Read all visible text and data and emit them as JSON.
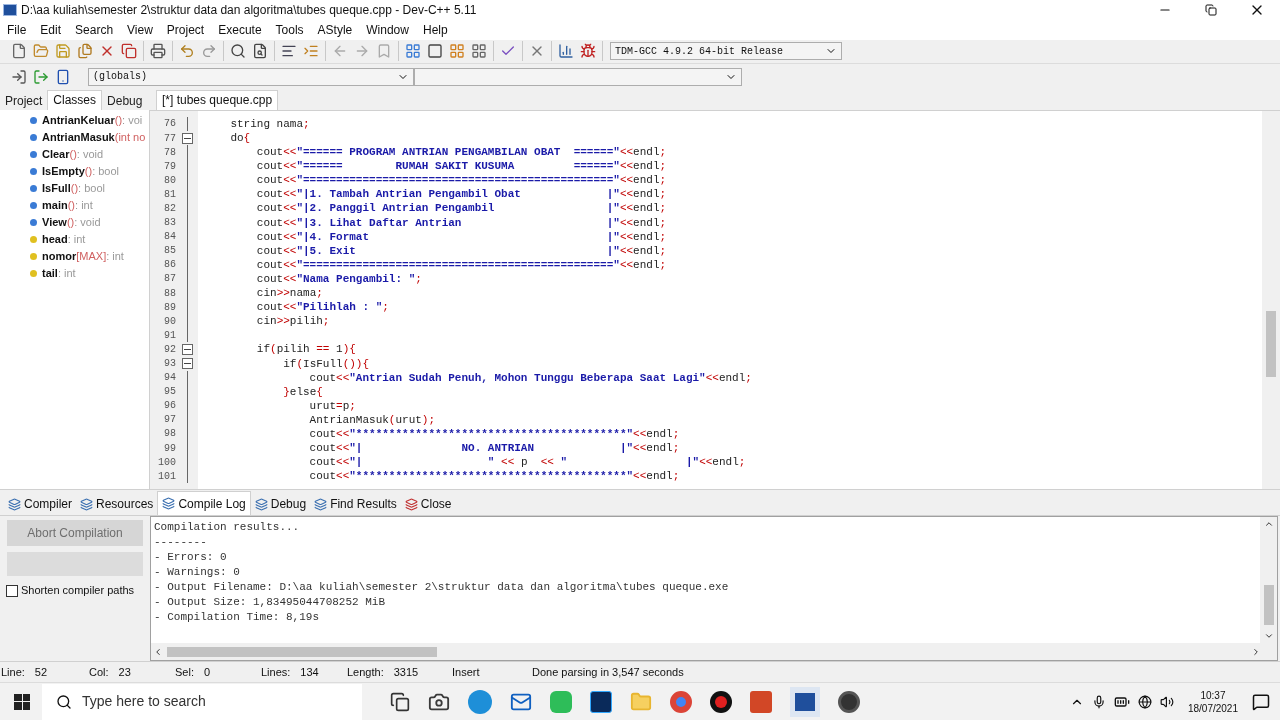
{
  "window": {
    "title": "D:\\aa kuliah\\semester 2\\struktur data dan algoritma\\tubes queque.cpp - Dev-C++ 5.11"
  },
  "menu": [
    "File",
    "Edit",
    "Search",
    "View",
    "Project",
    "Execute",
    "Tools",
    "AStyle",
    "Window",
    "Help"
  ],
  "compiler_select": {
    "value": "TDM-GCC 4.9.2 64-bit Release"
  },
  "scope_select": {
    "value": "(globals)"
  },
  "left_tabs": [
    {
      "label": "Project",
      "selected": false
    },
    {
      "label": "Classes",
      "selected": true
    },
    {
      "label": "Debug",
      "selected": false
    }
  ],
  "class_tree": [
    {
      "kind": "method",
      "name": "AntrianKeluar",
      "params": "()",
      "type": " : voi"
    },
    {
      "kind": "method",
      "name": "AntrianMasuk",
      "params": "(int no"
    },
    {
      "kind": "method",
      "name": "Clear",
      "params": "()",
      "type": " : void"
    },
    {
      "kind": "method",
      "name": "IsEmpty",
      "params": "()",
      "type": " : bool"
    },
    {
      "kind": "method",
      "name": "IsFull",
      "params": "()",
      "type": " : bool"
    },
    {
      "kind": "method",
      "name": "main",
      "params": "()",
      "type": " : int"
    },
    {
      "kind": "method",
      "name": "View",
      "params": "()",
      "type": " : void"
    },
    {
      "kind": "field",
      "name": "head",
      "type": " : int"
    },
    {
      "kind": "field",
      "name": "nomor",
      "params": " [MAX]",
      "type": " : int"
    },
    {
      "kind": "field",
      "name": "tail",
      "type": " : int"
    }
  ],
  "editor_tab": {
    "label": "[*] tubes queque.cpp"
  },
  "code": [
    {
      "n": "76",
      "fold": false,
      "segs": [
        {
          "kind": "id",
          "text": "    string nama"
        },
        {
          "kind": "op",
          "text": ";"
        }
      ]
    },
    {
      "n": "77",
      "fold": true,
      "segs": [
        {
          "kind": "id",
          "text": "    do"
        },
        {
          "kind": "op",
          "text": "{"
        }
      ]
    },
    {
      "n": "78",
      "fold": false,
      "segs": [
        {
          "kind": "id",
          "text": "        cout"
        },
        {
          "kind": "op",
          "text": "<<"
        },
        {
          "kind": "str",
          "text": "\"====== PROGRAM ANTRIAN PENGAMBILAN OBAT  ======\""
        },
        {
          "kind": "op",
          "text": "<<"
        },
        {
          "kind": "id",
          "text": "endl"
        },
        {
          "kind": "op",
          "text": ";"
        }
      ]
    },
    {
      "n": "79",
      "fold": false,
      "segs": [
        {
          "kind": "id",
          "text": "        cout"
        },
        {
          "kind": "op",
          "text": "<<"
        },
        {
          "kind": "str",
          "text": "\"======        RUMAH SAKIT KUSUMA         ======\""
        },
        {
          "kind": "op",
          "text": "<<"
        },
        {
          "kind": "id",
          "text": "endl"
        },
        {
          "kind": "op",
          "text": ";"
        }
      ]
    },
    {
      "n": "80",
      "fold": false,
      "segs": [
        {
          "kind": "id",
          "text": "        cout"
        },
        {
          "kind": "op",
          "text": "<<"
        },
        {
          "kind": "str",
          "text": "\"===============================================\""
        },
        {
          "kind": "op",
          "text": "<<"
        },
        {
          "kind": "id",
          "text": "endl"
        },
        {
          "kind": "op",
          "text": ";"
        }
      ]
    },
    {
      "n": "81",
      "fold": false,
      "segs": [
        {
          "kind": "id",
          "text": "        cout"
        },
        {
          "kind": "op",
          "text": "<<"
        },
        {
          "kind": "str",
          "text": "\"|1. Tambah Antrian Pengambil Obat             |\""
        },
        {
          "kind": "op",
          "text": "<<"
        },
        {
          "kind": "id",
          "text": "endl"
        },
        {
          "kind": "op",
          "text": ";"
        }
      ]
    },
    {
      "n": "82",
      "fold": false,
      "segs": [
        {
          "kind": "id",
          "text": "        cout"
        },
        {
          "kind": "op",
          "text": "<<"
        },
        {
          "kind": "str",
          "text": "\"|2. Panggil Antrian Pengambil                 |\""
        },
        {
          "kind": "op",
          "text": "<<"
        },
        {
          "kind": "id",
          "text": "endl"
        },
        {
          "kind": "op",
          "text": ";"
        }
      ]
    },
    {
      "n": "83",
      "fold": false,
      "segs": [
        {
          "kind": "id",
          "text": "        cout"
        },
        {
          "kind": "op",
          "text": "<<"
        },
        {
          "kind": "str",
          "text": "\"|3. Lihat Daftar Antrian                      |\""
        },
        {
          "kind": "op",
          "text": "<<"
        },
        {
          "kind": "id",
          "text": "endl"
        },
        {
          "kind": "op",
          "text": ";"
        }
      ]
    },
    {
      "n": "84",
      "fold": false,
      "segs": [
        {
          "kind": "id",
          "text": "        cout"
        },
        {
          "kind": "op",
          "text": "<<"
        },
        {
          "kind": "str",
          "text": "\"|4. Format                                    |\""
        },
        {
          "kind": "op",
          "text": "<<"
        },
        {
          "kind": "id",
          "text": "endl"
        },
        {
          "kind": "op",
          "text": ";"
        }
      ]
    },
    {
      "n": "85",
      "fold": false,
      "segs": [
        {
          "kind": "id",
          "text": "        cout"
        },
        {
          "kind": "op",
          "text": "<<"
        },
        {
          "kind": "str",
          "text": "\"|5. Exit                                      |\""
        },
        {
          "kind": "op",
          "text": "<<"
        },
        {
          "kind": "id",
          "text": "endl"
        },
        {
          "kind": "op",
          "text": ";"
        }
      ]
    },
    {
      "n": "86",
      "fold": false,
      "segs": [
        {
          "kind": "id",
          "text": "        cout"
        },
        {
          "kind": "op",
          "text": "<<"
        },
        {
          "kind": "str",
          "text": "\"===============================================\""
        },
        {
          "kind": "op",
          "text": "<<"
        },
        {
          "kind": "id",
          "text": "endl"
        },
        {
          "kind": "op",
          "text": ";"
        }
      ]
    },
    {
      "n": "87",
      "fold": false,
      "segs": [
        {
          "kind": "id",
          "text": "        cout"
        },
        {
          "kind": "op",
          "text": "<<"
        },
        {
          "kind": "str",
          "text": "\"Nama Pengambil: \""
        },
        {
          "kind": "op",
          "text": ";"
        }
      ]
    },
    {
      "n": "88",
      "fold": false,
      "segs": [
        {
          "kind": "id",
          "text": "        cin"
        },
        {
          "kind": "op",
          "text": ">>"
        },
        {
          "kind": "id",
          "text": "nama"
        },
        {
          "kind": "op",
          "text": ";"
        }
      ]
    },
    {
      "n": "89",
      "fold": false,
      "segs": [
        {
          "kind": "id",
          "text": "        cout"
        },
        {
          "kind": "op",
          "text": "<<"
        },
        {
          "kind": "str",
          "text": "\"Pilihlah : \""
        },
        {
          "kind": "op",
          "text": ";"
        }
      ]
    },
    {
      "n": "90",
      "fold": false,
      "segs": [
        {
          "kind": "id",
          "text": "        cin"
        },
        {
          "kind": "op",
          "text": ">>"
        },
        {
          "kind": "id",
          "text": "pilih"
        },
        {
          "kind": "op",
          "text": ";"
        }
      ]
    },
    {
      "n": "91",
      "fold": false
    },
    {
      "n": "92",
      "fold": true,
      "segs": [
        {
          "kind": "id",
          "text": "        if"
        },
        {
          "kind": "op",
          "text": "("
        },
        {
          "kind": "id",
          "text": "pilih "
        },
        {
          "kind": "op",
          "text": "=="
        },
        {
          "kind": "id",
          "text": " 1"
        },
        {
          "kind": "op",
          "text": "){"
        }
      ]
    },
    {
      "n": "93",
      "fold": true,
      "segs": [
        {
          "kind": "id",
          "text": "            if"
        },
        {
          "kind": "op",
          "text": "("
        },
        {
          "kind": "id",
          "text": "IsFull"
        },
        {
          "kind": "op",
          "text": "()){"
        }
      ]
    },
    {
      "n": "94",
      "fold": false,
      "segs": [
        {
          "kind": "id",
          "text": "                cout"
        },
        {
          "kind": "op",
          "text": "<<"
        },
        {
          "kind": "str",
          "text": "\"Antrian Sudah Penuh, Mohon Tunggu Beberapa Saat Lagi\""
        },
        {
          "kind": "op",
          "text": "<<"
        },
        {
          "kind": "id",
          "text": "endl"
        },
        {
          "kind": "op",
          "text": ";"
        }
      ]
    },
    {
      "n": "95",
      "fold": false,
      "segs": [
        {
          "kind": "op",
          "text": "            }"
        },
        {
          "kind": "id",
          "text": "else"
        },
        {
          "kind": "op",
          "text": "{"
        }
      ]
    },
    {
      "n": "96",
      "fold": false,
      "segs": [
        {
          "kind": "id",
          "text": "                urut"
        },
        {
          "kind": "op",
          "text": "="
        },
        {
          "kind": "id",
          "text": "p"
        },
        {
          "kind": "op",
          "text": ";"
        }
      ]
    },
    {
      "n": "97",
      "fold": false,
      "segs": [
        {
          "kind": "id",
          "text": "                AntrianMasuk"
        },
        {
          "kind": "op",
          "text": "("
        },
        {
          "kind": "id",
          "text": "urut"
        },
        {
          "kind": "op",
          "text": ");"
        }
      ]
    },
    {
      "n": "98",
      "fold": false,
      "segs": [
        {
          "kind": "id",
          "text": "                cout"
        },
        {
          "kind": "op",
          "text": "<<"
        },
        {
          "kind": "str",
          "text": "\"*****************************************\""
        },
        {
          "kind": "op",
          "text": "<<"
        },
        {
          "kind": "id",
          "text": "endl"
        },
        {
          "kind": "op",
          "text": ";"
        }
      ]
    },
    {
      "n": "99",
      "fold": false,
      "segs": [
        {
          "kind": "id",
          "text": "                cout"
        },
        {
          "kind": "op",
          "text": "<<"
        },
        {
          "kind": "str",
          "text": "\"|               NO. ANTRIAN             |\""
        },
        {
          "kind": "op",
          "text": "<<"
        },
        {
          "kind": "id",
          "text": "endl"
        },
        {
          "kind": "op",
          "text": ";"
        }
      ]
    },
    {
      "n": "100",
      "fold": false,
      "segs": [
        {
          "kind": "id",
          "text": "                cout"
        },
        {
          "kind": "op",
          "text": "<<"
        },
        {
          "kind": "str",
          "text": "\"|                   \""
        },
        {
          "kind": "op",
          "text": " << "
        },
        {
          "kind": "id",
          "text": "p  "
        },
        {
          "kind": "op",
          "text": "<<"
        },
        {
          "kind": "str",
          "text": " \"                  |\""
        },
        {
          "kind": "op",
          "text": "<<"
        },
        {
          "kind": "id",
          "text": "endl"
        },
        {
          "kind": "op",
          "text": ";"
        }
      ]
    },
    {
      "n": "101",
      "fold": false,
      "segs": [
        {
          "kind": "id",
          "text": "                cout"
        },
        {
          "kind": "op",
          "text": "<<"
        },
        {
          "kind": "str",
          "text": "\"*****************************************\""
        },
        {
          "kind": "op",
          "text": "<<"
        },
        {
          "kind": "id",
          "text": "endl"
        },
        {
          "kind": "op",
          "text": ";"
        }
      ]
    }
  ],
  "bottom_tabs": [
    {
      "label": "Compiler",
      "selected": false
    },
    {
      "label": "Resources",
      "selected": false
    },
    {
      "label": "Compile Log",
      "selected": true
    },
    {
      "label": "Debug",
      "selected": false
    },
    {
      "label": "Find Results",
      "selected": false
    },
    {
      "label": "Close",
      "selected": false
    }
  ],
  "abort_button": {
    "label": "Abort Compilation",
    "disabled": true
  },
  "shorten_paths": {
    "label": "Shorten compiler paths",
    "checked": false
  },
  "log": [
    "Compilation results...",
    "--------",
    "- Errors: 0",
    "- Warnings: 0",
    "- Output Filename: D:\\aa kuliah\\semester 2\\struktur data dan algoritma\\tubes queque.exe",
    "- Output Size: 1,83495044708252 MiB",
    "- Compilation Time: 8,19s"
  ],
  "status_bar": [
    {
      "label": "Line:",
      "value": "52"
    },
    {
      "label": "Col:",
      "value": "23"
    },
    {
      "label": "Sel:",
      "value": "0"
    },
    {
      "label": "Lines:",
      "value": "134"
    },
    {
      "label": "Length:",
      "value": "3315"
    }
  ],
  "status_mode": "Insert",
  "status_message": "Done parsing in 3,547 seconds",
  "taskbar": {
    "search_placeholder": "Type here to search",
    "time": "10:37",
    "date": "18/07/2021"
  }
}
